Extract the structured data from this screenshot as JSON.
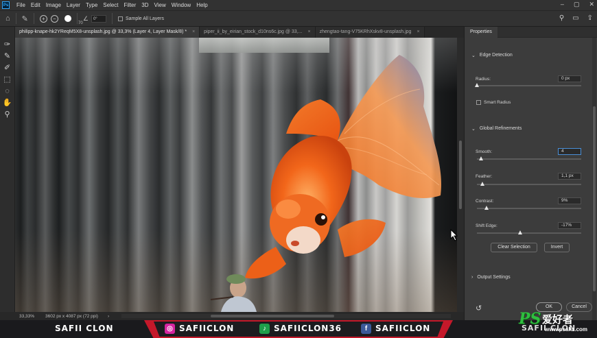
{
  "menu": {
    "logo": "Ps",
    "items": [
      "File",
      "Edit",
      "Image",
      "Layer",
      "Type",
      "Select",
      "Filter",
      "3D",
      "View",
      "Window",
      "Help"
    ],
    "window_controls": [
      "–",
      "▢",
      "✕"
    ]
  },
  "options": {
    "brush_size": "70",
    "angle": "0°",
    "sample_all_layers": "Sample All Layers"
  },
  "tabs": [
    {
      "label": "philipp-knape-hk2YReqM5X8-unsplash.jpg @ 33,3% (Layer 4, Layer Mask/8) *",
      "close": "×",
      "active": true
    },
    {
      "label": "piper_ii_by_eirian_stock_d10ns6c.jpg @ 33,...",
      "close": "×",
      "active": false
    },
    {
      "label": "zhengtao-tang-V75KRhXskv8-unsplash.jpg",
      "close": "×",
      "active": false
    }
  ],
  "status": {
    "zoom": "33,33%",
    "doc_info": "3602 px x 4087 px (72 ppi)"
  },
  "properties": {
    "title": "Properties",
    "edge_detection": "Edge Detection",
    "radius_label": "Radius:",
    "radius_value": "0 px",
    "radius_level": 0.0,
    "smart_radius": "Smart Radius",
    "global_refinements": "Global Refinements",
    "smooth_label": "Smooth:",
    "smooth_value": "4",
    "smooth_level": 0.04,
    "feather_label": "Feather:",
    "feather_value": "1,1 px",
    "feather_level": 0.05,
    "contrast_label": "Contrast:",
    "contrast_value": "9%",
    "contrast_level": 0.09,
    "shift_edge_label": "Shift Edge:",
    "shift_edge_value": "-17%",
    "shift_edge_level": 0.415,
    "clear_selection": "Clear Selection",
    "invert": "Invert",
    "output_settings": "Output Settings",
    "ok": "OK",
    "cancel": "Cancel"
  },
  "banner": {
    "name": "SAFII CLON",
    "instagram": "SAFIICLON",
    "tiktok": "SAFIICLON36",
    "facebook": "SAFIICLON",
    "right_name": "SAFII CLON",
    "watermark_ps": "PS",
    "watermark_cn": "爱好者",
    "watermark_url": "www.psahz.com"
  },
  "colors": {
    "accent_red": "#c4182a",
    "instagram": "#d6249f",
    "tiktok": "#1f9e4a",
    "facebook": "#3b5998",
    "fish_orange": "#f06a1c"
  }
}
